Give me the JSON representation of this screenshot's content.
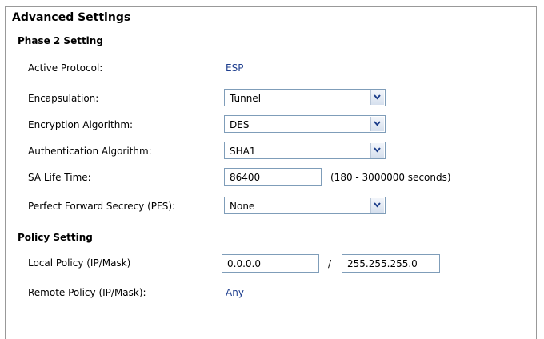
{
  "title": "Advanced Settings",
  "phase2": {
    "heading": "Phase 2 Setting",
    "active_protocol": {
      "label": "Active Protocol:",
      "value": "ESP"
    },
    "encapsulation": {
      "label": "Encapsulation:",
      "value": "Tunnel"
    },
    "encryption_algorithm": {
      "label": "Encryption Algorithm:",
      "value": "DES"
    },
    "authentication_algorithm": {
      "label": "Authentication Algorithm:",
      "value": "SHA1"
    },
    "sa_life_time": {
      "label": "SA Life Time:",
      "value": "86400",
      "hint": "(180 - 3000000 seconds)"
    },
    "pfs": {
      "label": "Perfect Forward Secrecy (PFS):",
      "value": "None"
    }
  },
  "policy": {
    "heading": "Policy Setting",
    "local_policy": {
      "label": "Local Policy (IP/Mask)",
      "ip": "0.0.0.0",
      "separator": "/",
      "mask": "255.255.255.0"
    },
    "remote_policy": {
      "label": "Remote Policy (IP/Mask):",
      "value": "Any"
    }
  },
  "icons": {
    "dropdown": "chevron-down-icon"
  },
  "colors": {
    "link": "#1f3f8f",
    "border": "#7f9db9"
  }
}
